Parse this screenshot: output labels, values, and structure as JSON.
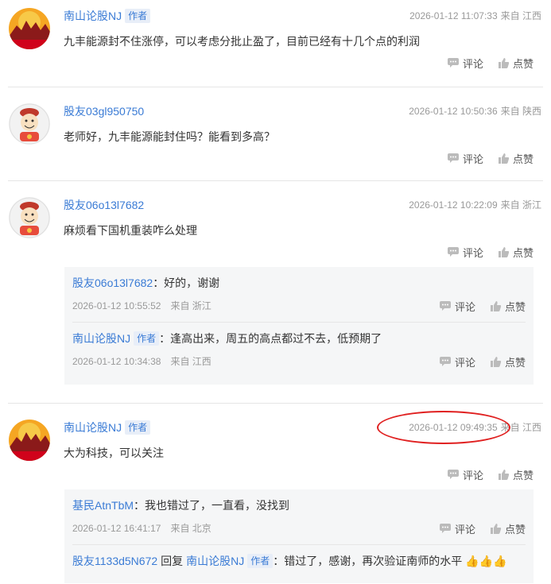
{
  "actions": {
    "comment_label": "评论",
    "like_label": "点赞"
  },
  "posts": [
    {
      "username": "南山论股NJ",
      "author_tag": "作者",
      "datetime": "2026-01-12 11:07:33",
      "source": "来自 江西",
      "content": "九丰能源封不住涨停，可以考虑分批止盈了，目前已经有十几个点的利润"
    },
    {
      "username": "股友03gl950750",
      "datetime": "2026-01-12 10:50:36",
      "source": "来自 陕西",
      "content": "老师好，九丰能源能封住吗？能看到多高？"
    },
    {
      "username": "股友06o13l7682",
      "datetime": "2026-01-12 10:22:09",
      "source": "来自 浙江",
      "content": "麻烦看下国机重装咋么处理",
      "replies": [
        {
          "username": "股友06o13l7682",
          "text": "：好的，谢谢",
          "datetime": "2026-01-12 10:55:52",
          "source": "来自 浙江"
        },
        {
          "username": "南山论股NJ",
          "author_tag": "作者",
          "text": "：逢高出来，周五的高点都过不去，低预期了",
          "datetime": "2026-01-12 10:34:38",
          "source": "来自 江西"
        }
      ]
    },
    {
      "username": "南山论股NJ",
      "author_tag": "作者",
      "datetime": "2026-01-12 09:49:35",
      "source": "来自 江西",
      "content": "大为科技，可以关注",
      "replies": [
        {
          "username": "基民AtnTbM",
          "text": "：我也错过了，一直看，没找到",
          "datetime": "2026-01-12 16:41:17",
          "source": "来自 北京"
        },
        {
          "username": "股友1133d5N672",
          "reply_word": "回复",
          "reply_to": "南山论股NJ",
          "author_tag": "作者",
          "text": "：错过了，感谢，再次验证南师的水平",
          "emoji": "👍👍👍"
        }
      ]
    }
  ]
}
